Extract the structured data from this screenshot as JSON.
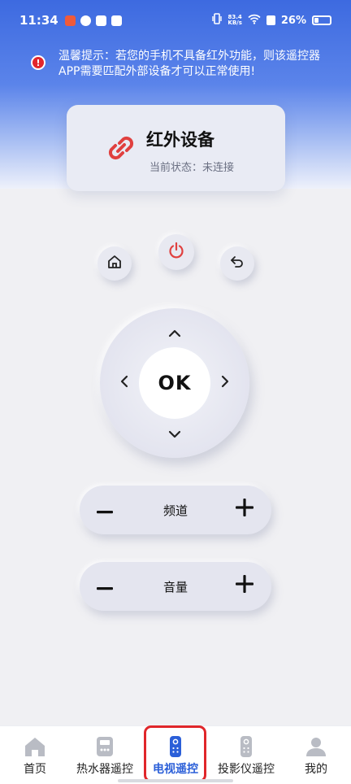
{
  "status_bar": {
    "time": "11:34",
    "network_speed_value": "83.4",
    "network_speed_unit": "KB/s",
    "battery": "26%"
  },
  "notice": {
    "text": "温馨提示：若您的手机不具备红外功能，则该遥控器APP需要匹配外部设备才可以正常使用!"
  },
  "device": {
    "title": "红外设备",
    "status": "当前状态：未连接"
  },
  "remote": {
    "ok_label": "OK",
    "channel_label": "频道",
    "volume_label": "音量"
  },
  "tabs": [
    {
      "label": "首页",
      "icon": "home-icon"
    },
    {
      "label": "热水器遥控",
      "icon": "water-heater-icon"
    },
    {
      "label": "电视遥控",
      "icon": "tv-remote-icon",
      "active": true
    },
    {
      "label": "投影仪遥控",
      "icon": "projector-remote-icon"
    },
    {
      "label": "我的",
      "icon": "user-icon"
    }
  ],
  "colors": {
    "accent": "#2b5fd8",
    "power": "#e0403f",
    "highlight": "#e0262a",
    "link_icon": "#e0403f"
  }
}
